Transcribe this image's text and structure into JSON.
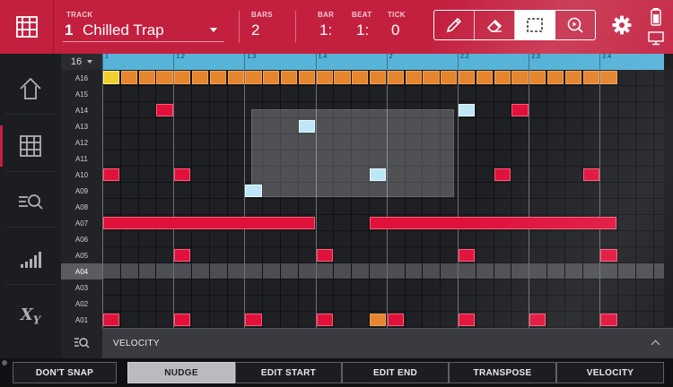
{
  "header": {
    "track_label": "TRACK",
    "track_number": "1",
    "track_name": "Chilled Trap",
    "bars_label": "BARS",
    "bars_value": "2",
    "bar_label": "BAR",
    "bar_value": "1:",
    "beat_label": "BEAT",
    "beat_value": "1:",
    "tick_label": "TICK",
    "tick_value": "0",
    "tools": [
      "pencil-icon",
      "eraser-icon",
      "marquee-select-icon",
      "zoom-play-icon"
    ],
    "active_tool": "marquee-select-icon"
  },
  "sidebar": {
    "items": [
      "up-arrow-icon",
      "grid-icon",
      "search-list-icon",
      "velocity-bars-icon",
      "xy-icon"
    ],
    "active_item": "grid-icon"
  },
  "editor": {
    "quantize": "16",
    "ruler_ticks": [
      "1",
      "1.2",
      "1.3",
      "1.4",
      "2",
      "2.2",
      "2.3",
      "2.4"
    ],
    "rows": [
      "A16",
      "A15",
      "A14",
      "A13",
      "A12",
      "A11",
      "A10",
      "A09",
      "A08",
      "A07",
      "A06",
      "A05",
      "A04",
      "A03",
      "A02",
      "A01"
    ],
    "selected_row": "A04",
    "columns_per_bar": 16,
    "total_columns": 32,
    "notes": [
      {
        "row": "A16",
        "start": 0,
        "length": 1,
        "color": "yellow"
      },
      {
        "row": "A16",
        "start": 1,
        "length": 1,
        "color": "orange"
      },
      {
        "row": "A16",
        "start": 2,
        "length": 1,
        "color": "orange"
      },
      {
        "row": "A16",
        "start": 3,
        "length": 1,
        "color": "orange"
      },
      {
        "row": "A16",
        "start": 4,
        "length": 1,
        "color": "orange"
      },
      {
        "row": "A16",
        "start": 5,
        "length": 1,
        "color": "orange"
      },
      {
        "row": "A16",
        "start": 6,
        "length": 1,
        "color": "orange"
      },
      {
        "row": "A16",
        "start": 7,
        "length": 1,
        "color": "orange"
      },
      {
        "row": "A16",
        "start": 8,
        "length": 1,
        "color": "orange"
      },
      {
        "row": "A16",
        "start": 9,
        "length": 1,
        "color": "orange"
      },
      {
        "row": "A16",
        "start": 10,
        "length": 1,
        "color": "orange"
      },
      {
        "row": "A16",
        "start": 11,
        "length": 1,
        "color": "orange"
      },
      {
        "row": "A16",
        "start": 12,
        "length": 1,
        "color": "orange"
      },
      {
        "row": "A16",
        "start": 13,
        "length": 1,
        "color": "orange"
      },
      {
        "row": "A16",
        "start": 14,
        "length": 1,
        "color": "orange"
      },
      {
        "row": "A16",
        "start": 15,
        "length": 1,
        "color": "orange"
      },
      {
        "row": "A16",
        "start": 16,
        "length": 1,
        "color": "orange"
      },
      {
        "row": "A16",
        "start": 17,
        "length": 1,
        "color": "orange"
      },
      {
        "row": "A16",
        "start": 18,
        "length": 1,
        "color": "orange"
      },
      {
        "row": "A16",
        "start": 19,
        "length": 1,
        "color": "orange"
      },
      {
        "row": "A16",
        "start": 20,
        "length": 1,
        "color": "orange"
      },
      {
        "row": "A16",
        "start": 21,
        "length": 1,
        "color": "orange"
      },
      {
        "row": "A16",
        "start": 22,
        "length": 1,
        "color": "orange"
      },
      {
        "row": "A16",
        "start": 23,
        "length": 1,
        "color": "orange"
      },
      {
        "row": "A16",
        "start": 24,
        "length": 1,
        "color": "orange"
      },
      {
        "row": "A16",
        "start": 25,
        "length": 1,
        "color": "orange"
      },
      {
        "row": "A16",
        "start": 26,
        "length": 1,
        "color": "orange"
      },
      {
        "row": "A16",
        "start": 27,
        "length": 1,
        "color": "orange"
      },
      {
        "row": "A16",
        "start": 28,
        "length": 1,
        "color": "orange"
      },
      {
        "row": "A14",
        "start": 3,
        "length": 1,
        "color": "red"
      },
      {
        "row": "A14",
        "start": 20,
        "length": 1,
        "color": "blue"
      },
      {
        "row": "A14",
        "start": 23,
        "length": 1,
        "color": "red"
      },
      {
        "row": "A13",
        "start": 11,
        "length": 1,
        "color": "blue"
      },
      {
        "row": "A10",
        "start": 0,
        "length": 1,
        "color": "red"
      },
      {
        "row": "A10",
        "start": 4,
        "length": 1,
        "color": "red"
      },
      {
        "row": "A10",
        "start": 15,
        "length": 1,
        "color": "blue"
      },
      {
        "row": "A10",
        "start": 22,
        "length": 1,
        "color": "red"
      },
      {
        "row": "A10",
        "start": 27,
        "length": 1,
        "color": "red"
      },
      {
        "row": "A09",
        "start": 8,
        "length": 1,
        "color": "blue"
      },
      {
        "row": "A07",
        "start": 0,
        "length": 12,
        "color": "red"
      },
      {
        "row": "A07",
        "start": 15,
        "length": 14,
        "color": "red"
      },
      {
        "row": "A05",
        "start": 4,
        "length": 1,
        "color": "red"
      },
      {
        "row": "A05",
        "start": 12,
        "length": 1,
        "color": "red"
      },
      {
        "row": "A05",
        "start": 20,
        "length": 1,
        "color": "red"
      },
      {
        "row": "A05",
        "start": 28,
        "length": 1,
        "color": "red"
      },
      {
        "row": "A01",
        "start": 0,
        "length": 1,
        "color": "red"
      },
      {
        "row": "A01",
        "start": 4,
        "length": 1,
        "color": "red"
      },
      {
        "row": "A01",
        "start": 8,
        "length": 1,
        "color": "red"
      },
      {
        "row": "A01",
        "start": 12,
        "length": 1,
        "color": "red"
      },
      {
        "row": "A01",
        "start": 15,
        "length": 1,
        "color": "orange"
      },
      {
        "row": "A01",
        "start": 16,
        "length": 1,
        "color": "red"
      },
      {
        "row": "A01",
        "start": 20,
        "length": 1,
        "color": "red"
      },
      {
        "row": "A01",
        "start": 24,
        "length": 1,
        "color": "red"
      },
      {
        "row": "A01",
        "start": 28,
        "length": 1,
        "color": "red"
      }
    ],
    "selection": {
      "row_from": "A14",
      "row_to": "A09",
      "start": 8,
      "end": 20
    }
  },
  "velocity_lane": {
    "label": "VELOCITY"
  },
  "bottom_buttons": [
    {
      "label": "DON'T SNAP",
      "active": false
    },
    {
      "label": "NUDGE",
      "active": true
    },
    {
      "label": "EDIT START",
      "active": false
    },
    {
      "label": "EDIT END",
      "active": false
    },
    {
      "label": "TRANSPOSE",
      "active": false
    },
    {
      "label": "VELOCITY",
      "active": false
    }
  ],
  "colors": {
    "accent": "#c3203f",
    "note_red": "#e0123c",
    "note_orange": "#e5852e",
    "note_yellow": "#f0cf2e",
    "note_selected": "#bde7f7",
    "ruler": "#57b3d8"
  }
}
